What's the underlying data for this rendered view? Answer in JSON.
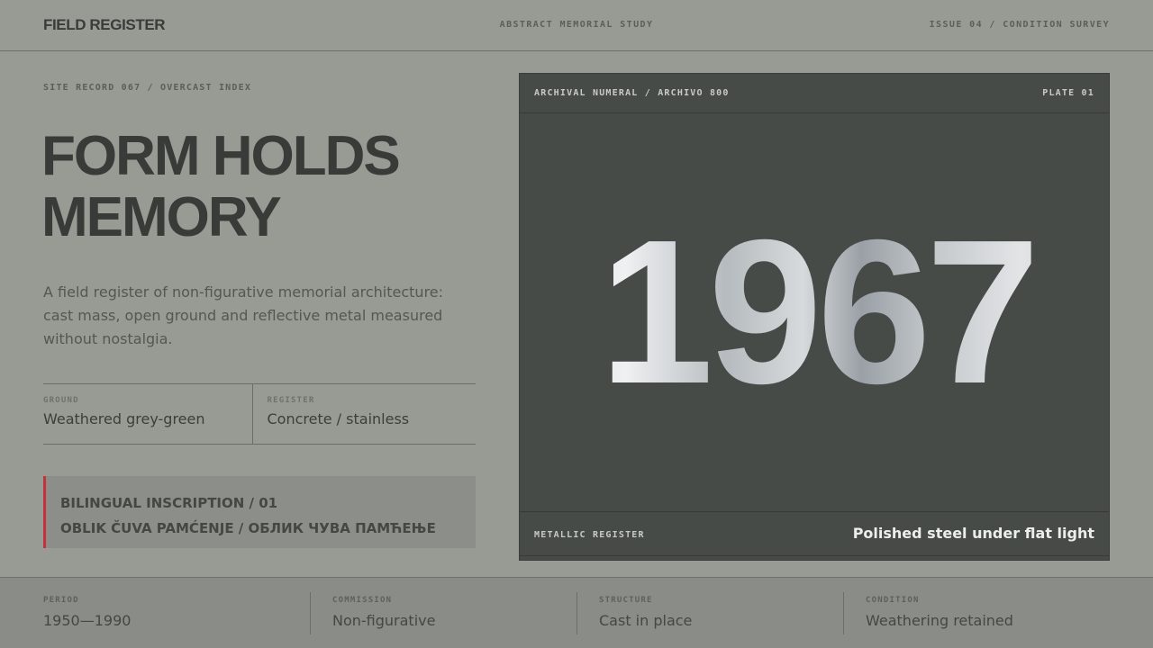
{
  "header": {
    "brand": "FIELD REGISTER",
    "center": "ABSTRACT MEMORIAL STUDY",
    "right": "ISSUE 04 / CONDITION SURVEY"
  },
  "intro": {
    "eyebrow": "SITE RECORD 067 / OVERCAST INDEX",
    "headline_line1": "FORM HOLDS",
    "headline_line2": "MEMORY",
    "lede": "A field register of non-figurative memorial architecture: cast mass, open ground and reflective metal measured without nostalgia."
  },
  "specs": [
    {
      "label": "GROUND",
      "value": "Weathered grey-green"
    },
    {
      "label": "REGISTER",
      "value": "Concrete / stainless"
    }
  ],
  "inscription": {
    "title": "BILINGUAL INSCRIPTION / 01",
    "text": "OBLIK ČUVA PAMĆENJE / ОБЛИК ЧУВА ПАМЋЕЊЕ",
    "accent_color": "#c8303b"
  },
  "plate": {
    "header_left": "ARCHIVAL NUMERAL / ARCHIVO 800",
    "header_right": "PLATE 01",
    "numeral": "1967",
    "footer_left": "METALLIC REGISTER",
    "footer_right": "Polished steel under flat light"
  },
  "footer": [
    {
      "label": "PERIOD",
      "value": "1950—1990"
    },
    {
      "label": "COMMISSION",
      "value": "Non-figurative"
    },
    {
      "label": "STRUCTURE",
      "value": "Cast in place"
    },
    {
      "label": "CONDITION",
      "value": "Weathering retained"
    }
  ]
}
